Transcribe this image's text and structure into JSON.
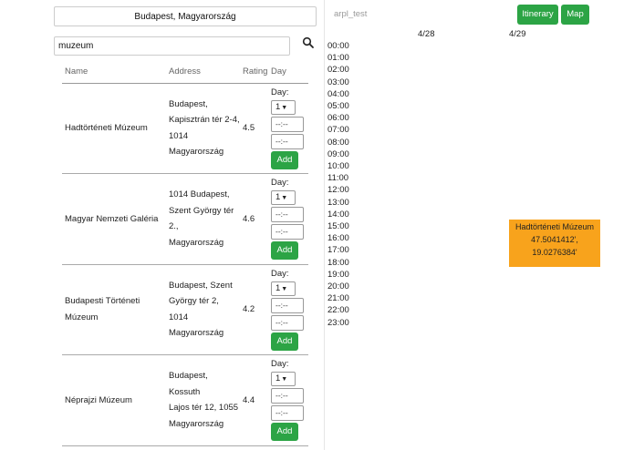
{
  "city": "Budapest, Magyarország",
  "search": {
    "value": "muzeum"
  },
  "table": {
    "headers": [
      "Name",
      "Address",
      "Rating",
      "Day"
    ],
    "rows": [
      {
        "name": "Hadtörténeti Múzeum",
        "address": [
          "Budapest,",
          "Kapisztrán tér 2-4,",
          "1014",
          "Magyarország"
        ],
        "rating": "4.5",
        "day_label": "Day:",
        "day_value": "1",
        "time_start": "--:--",
        "time_end": "--:--",
        "add_label": "Add"
      },
      {
        "name": "Magyar Nemzeti Galéria",
        "address": [
          "1014 Budapest,",
          "Szent György tér 2.,",
          "Magyarország"
        ],
        "rating": "4.6",
        "day_label": "Day:",
        "day_value": "1",
        "time_start": "--:--",
        "time_end": "--:--",
        "add_label": "Add"
      },
      {
        "name": "Budapesti Történeti Múzeum",
        "address": [
          "Budapest, Szent",
          "György tér 2, 1014",
          "Magyarország"
        ],
        "rating": "4.2",
        "day_label": "Day:",
        "day_value": "1",
        "time_start": "--:--",
        "time_end": "--:--",
        "add_label": "Add"
      },
      {
        "name": "Néprajzi Múzeum",
        "address": [
          "Budapest, Kossuth",
          "Lajos tér 12, 1055",
          "Magyarország"
        ],
        "rating": "4.4",
        "day_label": "Day:",
        "day_value": "1",
        "time_start": "--:--",
        "time_end": "--:--",
        "add_label": "Add"
      }
    ]
  },
  "project": "arpl_test",
  "buttons": {
    "itinerary": "Itinerary",
    "map": "Map"
  },
  "dates": [
    "4/28",
    "4/29"
  ],
  "hours": [
    "00:00",
    "01:00",
    "02:00",
    "03:00",
    "04:00",
    "05:00",
    "06:00",
    "07:00",
    "08:00",
    "09:00",
    "10:00",
    "11:00",
    "12:00",
    "13:00",
    "14:00",
    "15:00",
    "16:00",
    "17:00",
    "18:00",
    "19:00",
    "20:00",
    "21:00",
    "22:00",
    "23:00"
  ],
  "event": {
    "title": "Hadtörténeti Múzeum",
    "coord1": "47.5041412',",
    "coord2": "19.0276384'"
  },
  "colors": {
    "accent_green": "#2ca445",
    "event_orange": "#f8a31c"
  },
  "icons": {
    "search": "search-icon",
    "dropdown": "chevron-down-icon"
  }
}
